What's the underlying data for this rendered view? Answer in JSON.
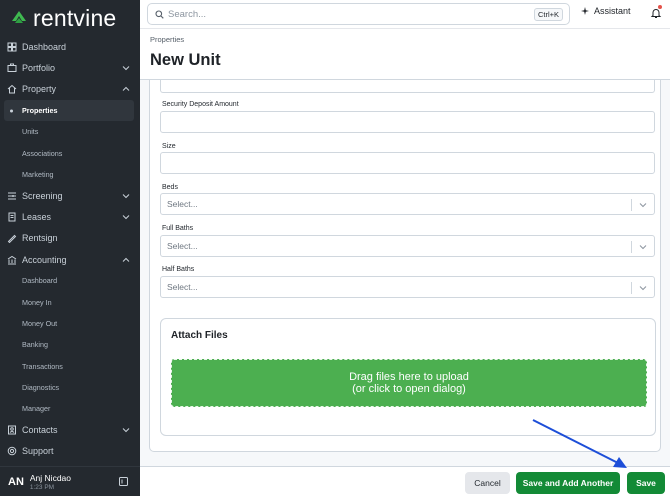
{
  "app": {
    "brand": "rentvine"
  },
  "sidebar": {
    "items": [
      {
        "label": "Dashboard",
        "icon": "dashboard-icon"
      },
      {
        "label": "Portfolio",
        "icon": "portfolio-icon",
        "expandable": true
      },
      {
        "label": "Property",
        "icon": "property-icon",
        "expanded": true
      },
      {
        "label": "Properties",
        "sub": true,
        "active": true
      },
      {
        "label": "Units",
        "sub": true
      },
      {
        "label": "Associations",
        "sub": true
      },
      {
        "label": "Marketing",
        "sub": true
      },
      {
        "label": "Screening",
        "icon": "screening-icon",
        "expandable": true
      },
      {
        "label": "Leases",
        "icon": "leases-icon",
        "expandable": true
      },
      {
        "label": "Rentsign",
        "icon": "rentsign-icon"
      },
      {
        "label": "Accounting",
        "icon": "accounting-icon",
        "expanded": true
      },
      {
        "label": "Dashboard",
        "sub": true
      },
      {
        "label": "Money In",
        "sub": true
      },
      {
        "label": "Money Out",
        "sub": true
      },
      {
        "label": "Banking",
        "sub": true
      },
      {
        "label": "Transactions",
        "sub": true
      },
      {
        "label": "Diagnostics",
        "sub": true
      },
      {
        "label": "Manager",
        "sub": true
      },
      {
        "label": "Contacts",
        "icon": "contacts-icon",
        "expandable": true
      },
      {
        "label": "Support",
        "icon": "support-icon"
      }
    ],
    "user": {
      "initials": "AN",
      "name": "Anj Nicdao",
      "time": "1:23 PM"
    }
  },
  "topbar": {
    "search_placeholder": "Search...",
    "shortcut": "Ctrl+K",
    "assistant_label": "Assistant"
  },
  "header": {
    "breadcrumb": "Properties",
    "title": "New Unit"
  },
  "form": {
    "security_deposit_label": "Security Deposit Amount",
    "size_label": "Size",
    "beds_label": "Beds",
    "beds_value": "Select...",
    "full_baths_label": "Full Baths",
    "full_baths_value": "Select...",
    "half_baths_label": "Half Baths",
    "half_baths_value": "Select...",
    "attach_title": "Attach Files",
    "dropzone_line1": "Drag files here to upload",
    "dropzone_line2": "(or click to open dialog)"
  },
  "footer": {
    "cancel_label": "Cancel",
    "save_another_label": "Save and Add Another",
    "save_label": "Save"
  },
  "colors": {
    "sidebar_bg": "#24292f",
    "primary_green": "#138a36",
    "dropzone_green": "#4caf50",
    "annotation_arrow": "#1d4ed8"
  }
}
